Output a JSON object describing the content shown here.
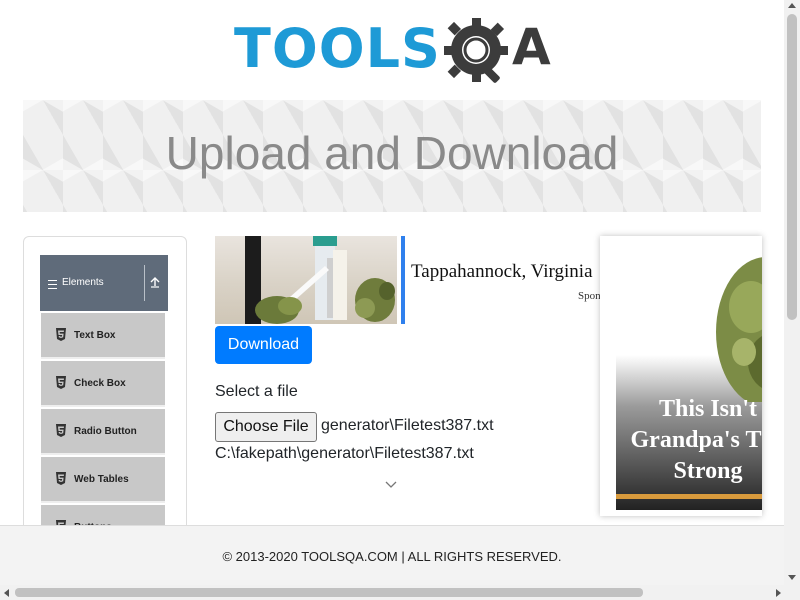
{
  "logo": {
    "part1": "TOOLS",
    "part2_letter": "A",
    "alt": "TOOLSQA"
  },
  "page": {
    "title": "Upload and Download"
  },
  "sidebar": {
    "group_label": "Elements",
    "group_icon": "hamburger-icon",
    "collapse_icon": "collapse-up-icon",
    "items": [
      {
        "label": "Text Box",
        "icon": "html5-icon"
      },
      {
        "label": "Check Box",
        "icon": "html5-icon"
      },
      {
        "label": "Radio Button",
        "icon": "html5-icon"
      },
      {
        "label": "Web Tables",
        "icon": "html5-icon"
      },
      {
        "label": "Buttons",
        "icon": "html5-icon"
      }
    ]
  },
  "ad_left": {
    "headline": "Tappahannock, Virginia",
    "sponsored": "Spon"
  },
  "main": {
    "download_label": "Download",
    "select_file_label": "Select a file",
    "choose_file_label": "Choose File",
    "chosen_file": "generator\\Filetest387.txt",
    "uploaded_path": "C:\\fakepath\\generator\\Filetest387.txt"
  },
  "ad_right": {
    "line1": "This Isn't",
    "line2": "Grandpa's The",
    "line3": "Strong"
  },
  "footer": {
    "text": "© 2013-2020 TOOLSQA.COM | ALL RIGHTS RESERVED."
  },
  "colors": {
    "brand_blue": "#1e9ad6",
    "primary_button": "#007bff",
    "sidebar_header": "#5f6b7a",
    "ad_accent": "#2f80ed"
  }
}
